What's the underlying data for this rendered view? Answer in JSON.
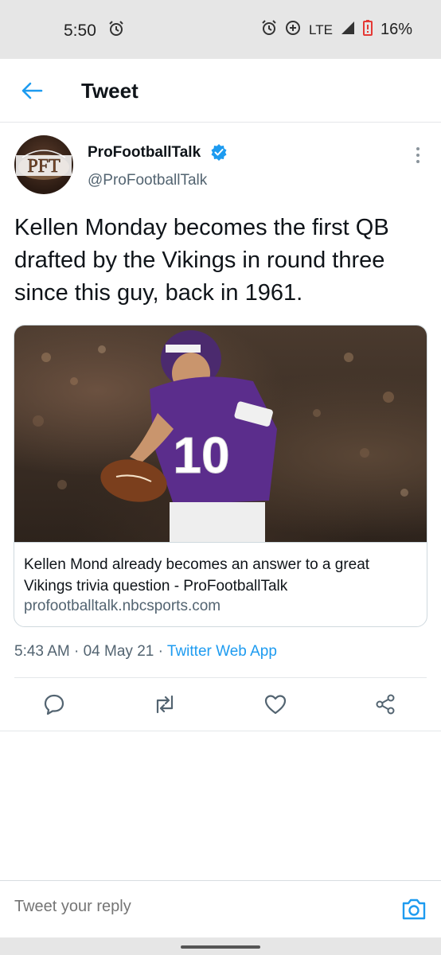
{
  "status_bar": {
    "time": "5:50",
    "network": "LTE",
    "battery": "16%"
  },
  "header": {
    "title": "Tweet",
    "back_icon": "arrow-left-icon",
    "accent": "#1d9bf0"
  },
  "tweet": {
    "author_name": "ProFootballTalk",
    "handle": "@ProFootballTalk",
    "avatar_text": "PFT",
    "verified_icon": "verified-badge-icon",
    "text": "Kellen Monday becomes the first QB drafted by the Vikings in round three since this guy, back in 1961.",
    "card": {
      "title": "Kellen Mond already becomes an answer to a great Vikings trivia question - ProFootballTalk",
      "domain": "profootballtalk.nbcsports.com",
      "jersey_number": "10"
    },
    "meta": {
      "time": "5:43 AM",
      "separator": "·",
      "date": "04 May 21",
      "app": "Twitter Web App"
    }
  },
  "actions": {
    "reply": "reply-icon",
    "retweet": "retweet-icon",
    "like": "heart-icon",
    "share": "share-icon"
  },
  "reply_bar": {
    "placeholder": "Tweet your reply"
  }
}
